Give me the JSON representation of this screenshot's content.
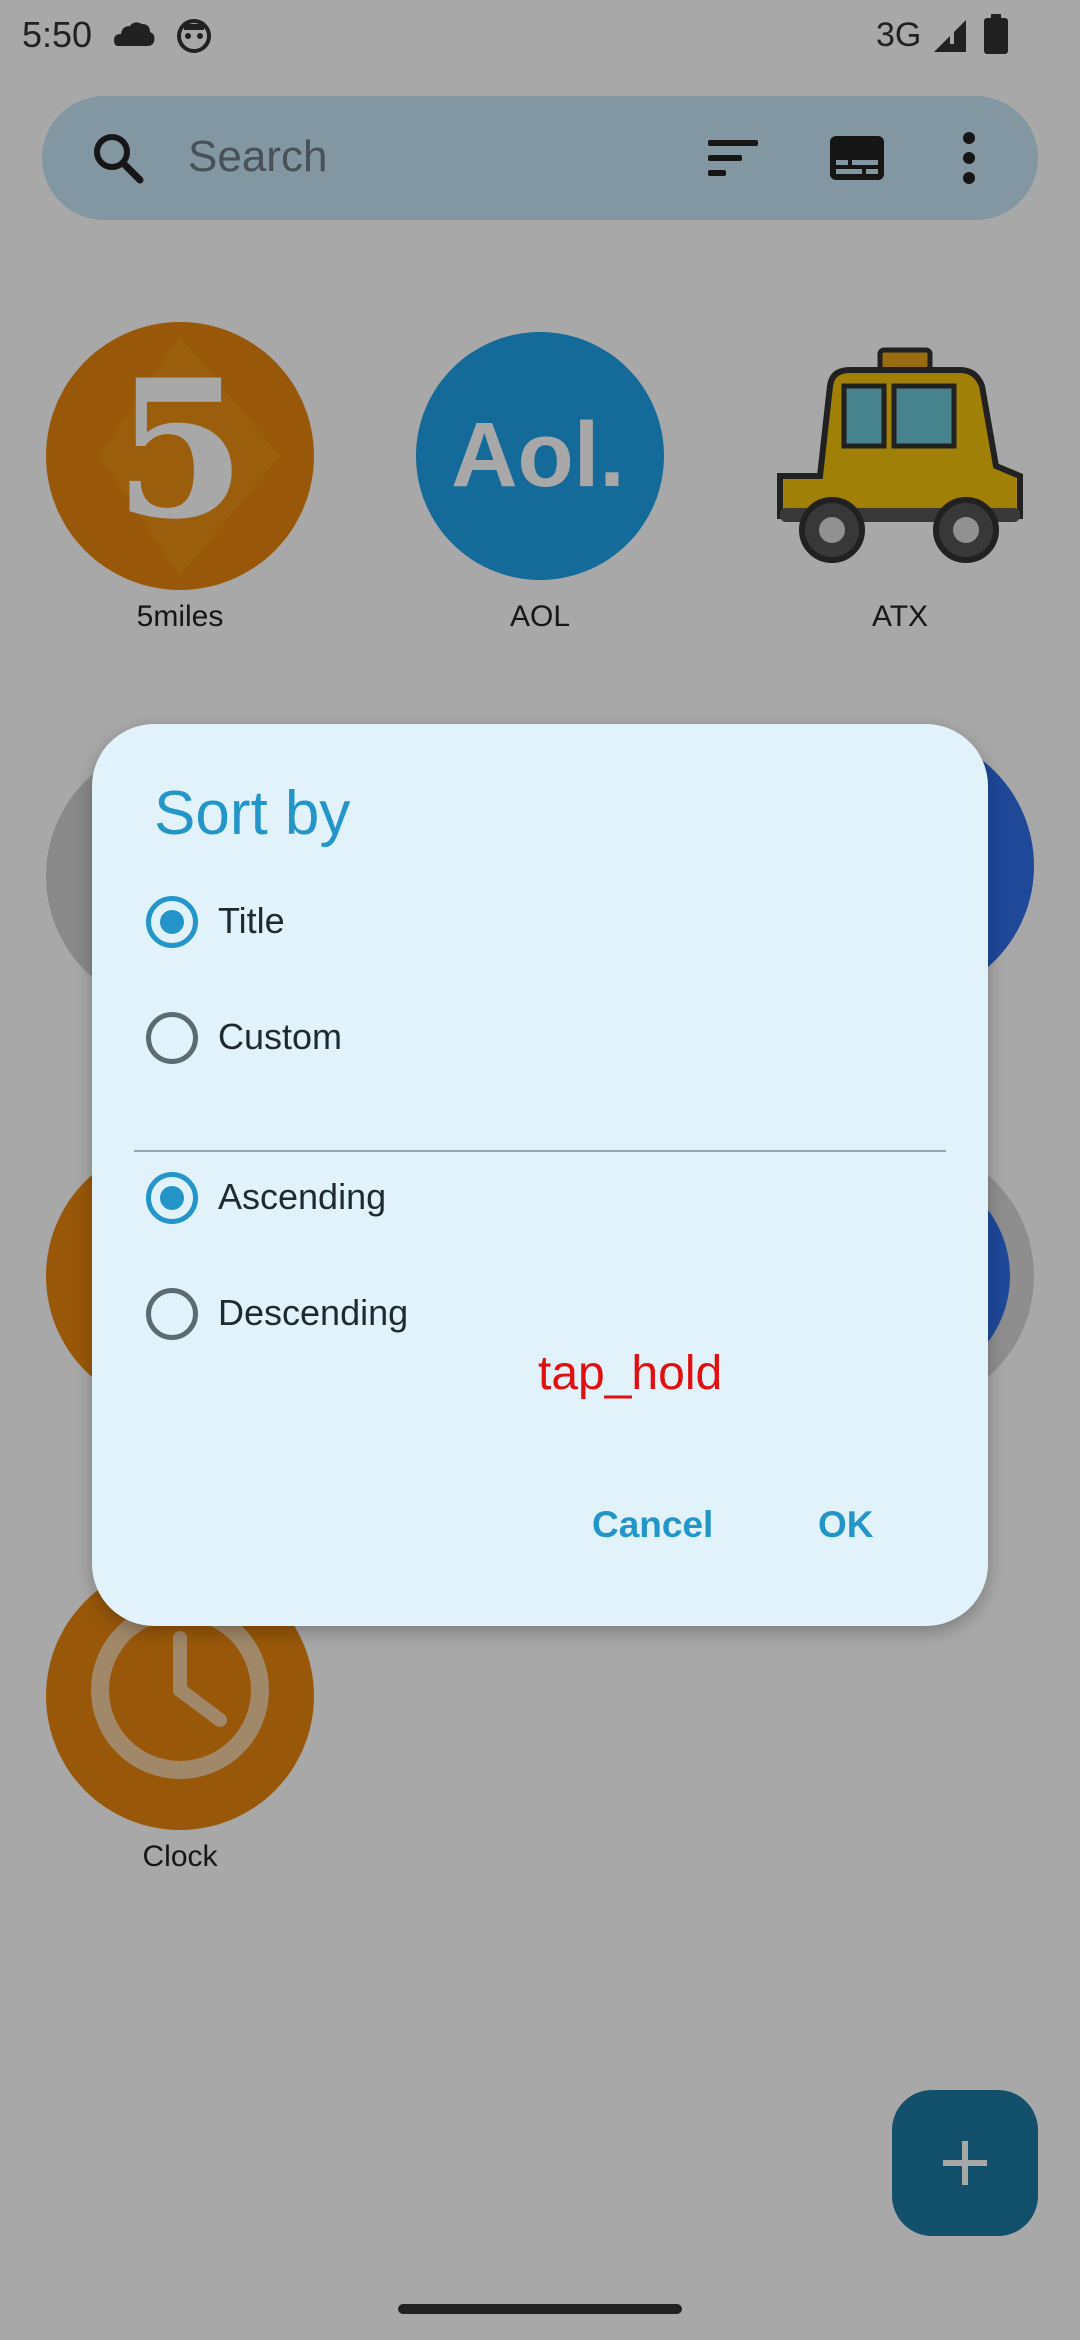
{
  "status_bar": {
    "time": "5:50",
    "network": "3G"
  },
  "search": {
    "placeholder": "Search"
  },
  "apps": [
    {
      "label": "5miles",
      "icon": "5miles-icon",
      "icon_text": "5",
      "color": "#e8860f"
    },
    {
      "label": "AOL",
      "icon": "aol-icon",
      "icon_text": "Aol.",
      "color": "#1fa3e8"
    },
    {
      "label": "ATX",
      "icon": "taxi-icon",
      "color": "#f4c20d"
    },
    {
      "label": "Clock",
      "icon": "clock-icon",
      "color": "#e8860f"
    }
  ],
  "dialog": {
    "title": "Sort by",
    "sort_field": {
      "options": [
        {
          "label": "Title",
          "checked": true
        },
        {
          "label": "Custom",
          "checked": false
        }
      ]
    },
    "sort_order": {
      "options": [
        {
          "label": "Ascending",
          "checked": true
        },
        {
          "label": "Descending",
          "checked": false
        }
      ]
    },
    "cancel_label": "Cancel",
    "ok_label": "OK"
  },
  "overlay": {
    "action_label": "tap_hold"
  },
  "colors": {
    "accent": "#2495c8",
    "dialog_bg": "#e2f2fb",
    "search_bg": "#c6e6f4",
    "fab": "#1e7aa5",
    "overlay_text": "#e01010"
  }
}
